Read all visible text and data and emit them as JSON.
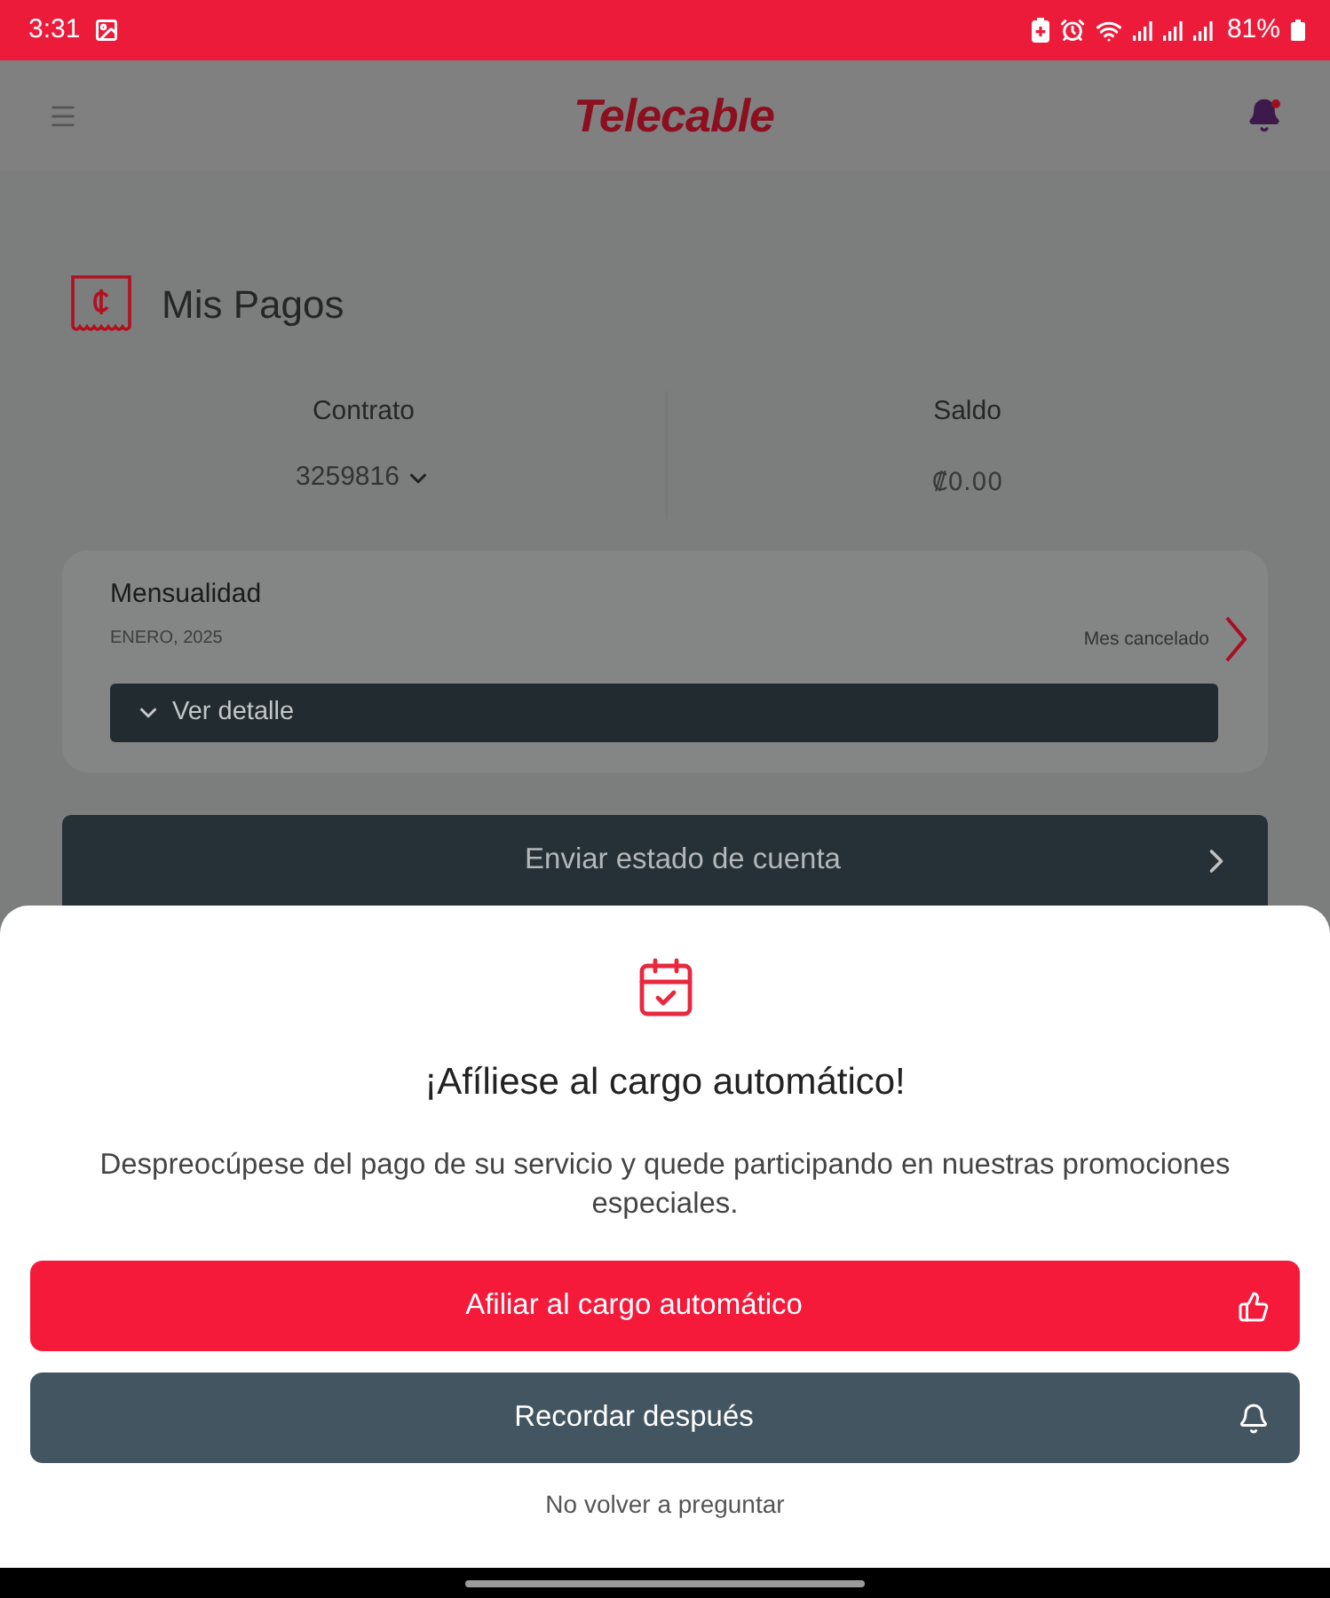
{
  "status_bar": {
    "time": "3:31",
    "battery": "81%"
  },
  "header": {
    "logo": "Telecable"
  },
  "page": {
    "title": "Mis Pagos",
    "summary": [
      {
        "label": "Contrato",
        "value": "3259816",
        "kind": "dropdown"
      },
      {
        "label": "Saldo",
        "value": "₡0.00",
        "kind": "plain"
      }
    ]
  },
  "payment_card": {
    "title": "Mensualidad",
    "period": "ENERO, 2025",
    "status": "Mes cancelado",
    "detail_button": "Ver detalle"
  },
  "statement_button": "Enviar estado de cuenta",
  "dialog": {
    "title": "¡Afíliese al cargo automático!",
    "message": "Despreocúpese del pago de su servicio y quede participando en nuestras promociones especiales.",
    "buttons": [
      {
        "label": "Afiliar al cargo automático",
        "kind": "primary"
      },
      {
        "label": "Recordar después",
        "kind": "secondary"
      }
    ],
    "link": "No volver a preguntar"
  }
}
